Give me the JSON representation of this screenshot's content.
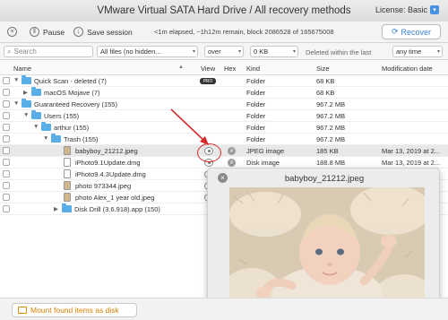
{
  "window": {
    "title": "VMware Virtual SATA Hard Drive / All recovery methods",
    "license_label": "License: Basic"
  },
  "toolbar": {
    "pause_label": "Pause",
    "save_label": "Save session",
    "status": "<1m elapsed, ~1h12m remain, block 2086528 of 165675008",
    "recover_label": "Recover"
  },
  "filters": {
    "search_placeholder": "Search",
    "files_filter": "All files (no hidden...",
    "size_op": "over",
    "size_value": "0 KB",
    "deleted_label": "Deleted within the last",
    "time_range": "any time"
  },
  "columns": {
    "name": "Name",
    "view": "View",
    "hex": "Hex",
    "kind": "Kind",
    "size": "Size",
    "modified": "Modification date"
  },
  "rows": [
    {
      "name": "Quick Scan - deleted (7)",
      "kind": "Folder",
      "size": "68 KB",
      "modified": ""
    },
    {
      "name": "macOS Mojave (7)",
      "kind": "Folder",
      "size": "68 KB",
      "modified": ""
    },
    {
      "name": "Guaranteed Recovery (155)",
      "kind": "Folder",
      "size": "967.2 MB",
      "modified": ""
    },
    {
      "name": "Users (155)",
      "kind": "Folder",
      "size": "967.2 MB",
      "modified": ""
    },
    {
      "name": "arthur (155)",
      "kind": "Folder",
      "size": "967.2 MB",
      "modified": ""
    },
    {
      "name": "Trash (155)",
      "kind": "Folder",
      "size": "967.2 MB",
      "modified": ""
    },
    {
      "name": "babyboy_21212.jpeg",
      "kind": "JPEG image",
      "size": "185 KB",
      "modified": "Mar 13, 2019 at 2..."
    },
    {
      "name": "iPhoto9.1Update.dmg",
      "kind": "Disk image",
      "size": "188.8 MB",
      "modified": "Mar 13, 2019 at 2..."
    },
    {
      "name": "iPhoto9.4.3Update.dmg",
      "kind": "",
      "size": "",
      "modified": ""
    },
    {
      "name": "photo 973344.jpeg",
      "kind": "",
      "size": "",
      "modified": ""
    },
    {
      "name": "photo Alex_1 year old.jpeg",
      "kind": "",
      "size": "",
      "modified": ""
    },
    {
      "name": "Disk Drill (3.6.918).app (150)",
      "kind": "",
      "size": "",
      "modified": ""
    }
  ],
  "badges": {
    "pro": "PRO"
  },
  "preview": {
    "title": "babyboy_21212.jpeg"
  },
  "footer": {
    "mount_label": "Mount found items as disk"
  },
  "colors": {
    "folder": "#5aaee8",
    "accent": "#3a83d6",
    "highlight": "#d62b2b",
    "mount": "#d88000"
  },
  "icons": [
    "pause-icon",
    "close-icon",
    "save-icon",
    "recover-icon",
    "search-icon",
    "folder-icon",
    "file-icon",
    "eye-icon",
    "hex-icon",
    "arrow-icon",
    "drive-icon"
  ]
}
